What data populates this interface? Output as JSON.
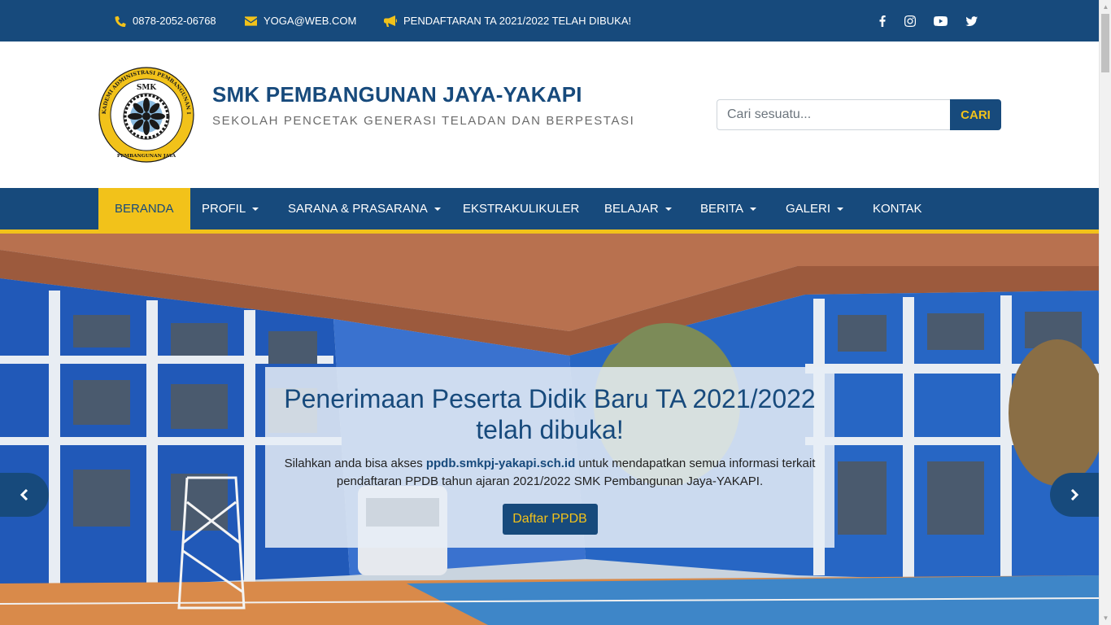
{
  "topbar": {
    "phone": "0878-2052-06768",
    "email": "YOGA@WEB.COM",
    "announcement": "PENDAFTARAN TA 2021/2022 TELAH DIBUKA!",
    "phone_icon": "phone-icon",
    "email_icon": "envelope-icon",
    "announcement_icon": "megaphone-icon",
    "social_icons": [
      "facebook-icon",
      "instagram-icon",
      "youtube-icon",
      "twitter-icon"
    ]
  },
  "header": {
    "logo_top_text": "SMK",
    "logo_ring_text": "YAYASAN AKADEMI ADMINISTRASI PEMBANGUNAN INDONESIA",
    "logo_bottom_text": "PEMBANGUNAN JAYA",
    "title": "SMK PEMBANGUNAN JAYA-YAKAPI",
    "tagline": "SEKOLAH PENCETAK GENERASI TELADAN DAN BERPESTASI",
    "search_placeholder": "Cari sesuatu...",
    "search_button": "CARI"
  },
  "nav": {
    "items": [
      {
        "label": "BERANDA",
        "active": true,
        "dropdown": false
      },
      {
        "label": "PROFIL",
        "active": false,
        "dropdown": true
      },
      {
        "label": "SARANA & PRASARANA",
        "active": false,
        "dropdown": true
      },
      {
        "label": "EKSTRAKULIKULER",
        "active": false,
        "dropdown": false
      },
      {
        "label": "BELAJAR",
        "active": false,
        "dropdown": true
      },
      {
        "label": "BERITA",
        "active": false,
        "dropdown": true
      },
      {
        "label": "GALERI",
        "active": false,
        "dropdown": true
      },
      {
        "label": "KONTAK",
        "active": false,
        "dropdown": false
      }
    ]
  },
  "hero": {
    "heading": "Penerimaan Peserta Didik Baru TA 2021/2022 telah dibuka!",
    "text_before": "Silahkan anda bisa akses ",
    "link": "ppdb.smkpj-yakapi.sch.id",
    "text_after": " untuk mendapatkan semua informasi terkait pendaftaran PPDB tahun ajaran 2021/2022 SMK Pembangunan Jaya-YAKAPI.",
    "button": "Daftar PPDB",
    "prev_icon": "chevron-left-icon",
    "next_icon": "chevron-right-icon"
  },
  "colors": {
    "primary": "#174a7c",
    "accent": "#f2c21a"
  }
}
